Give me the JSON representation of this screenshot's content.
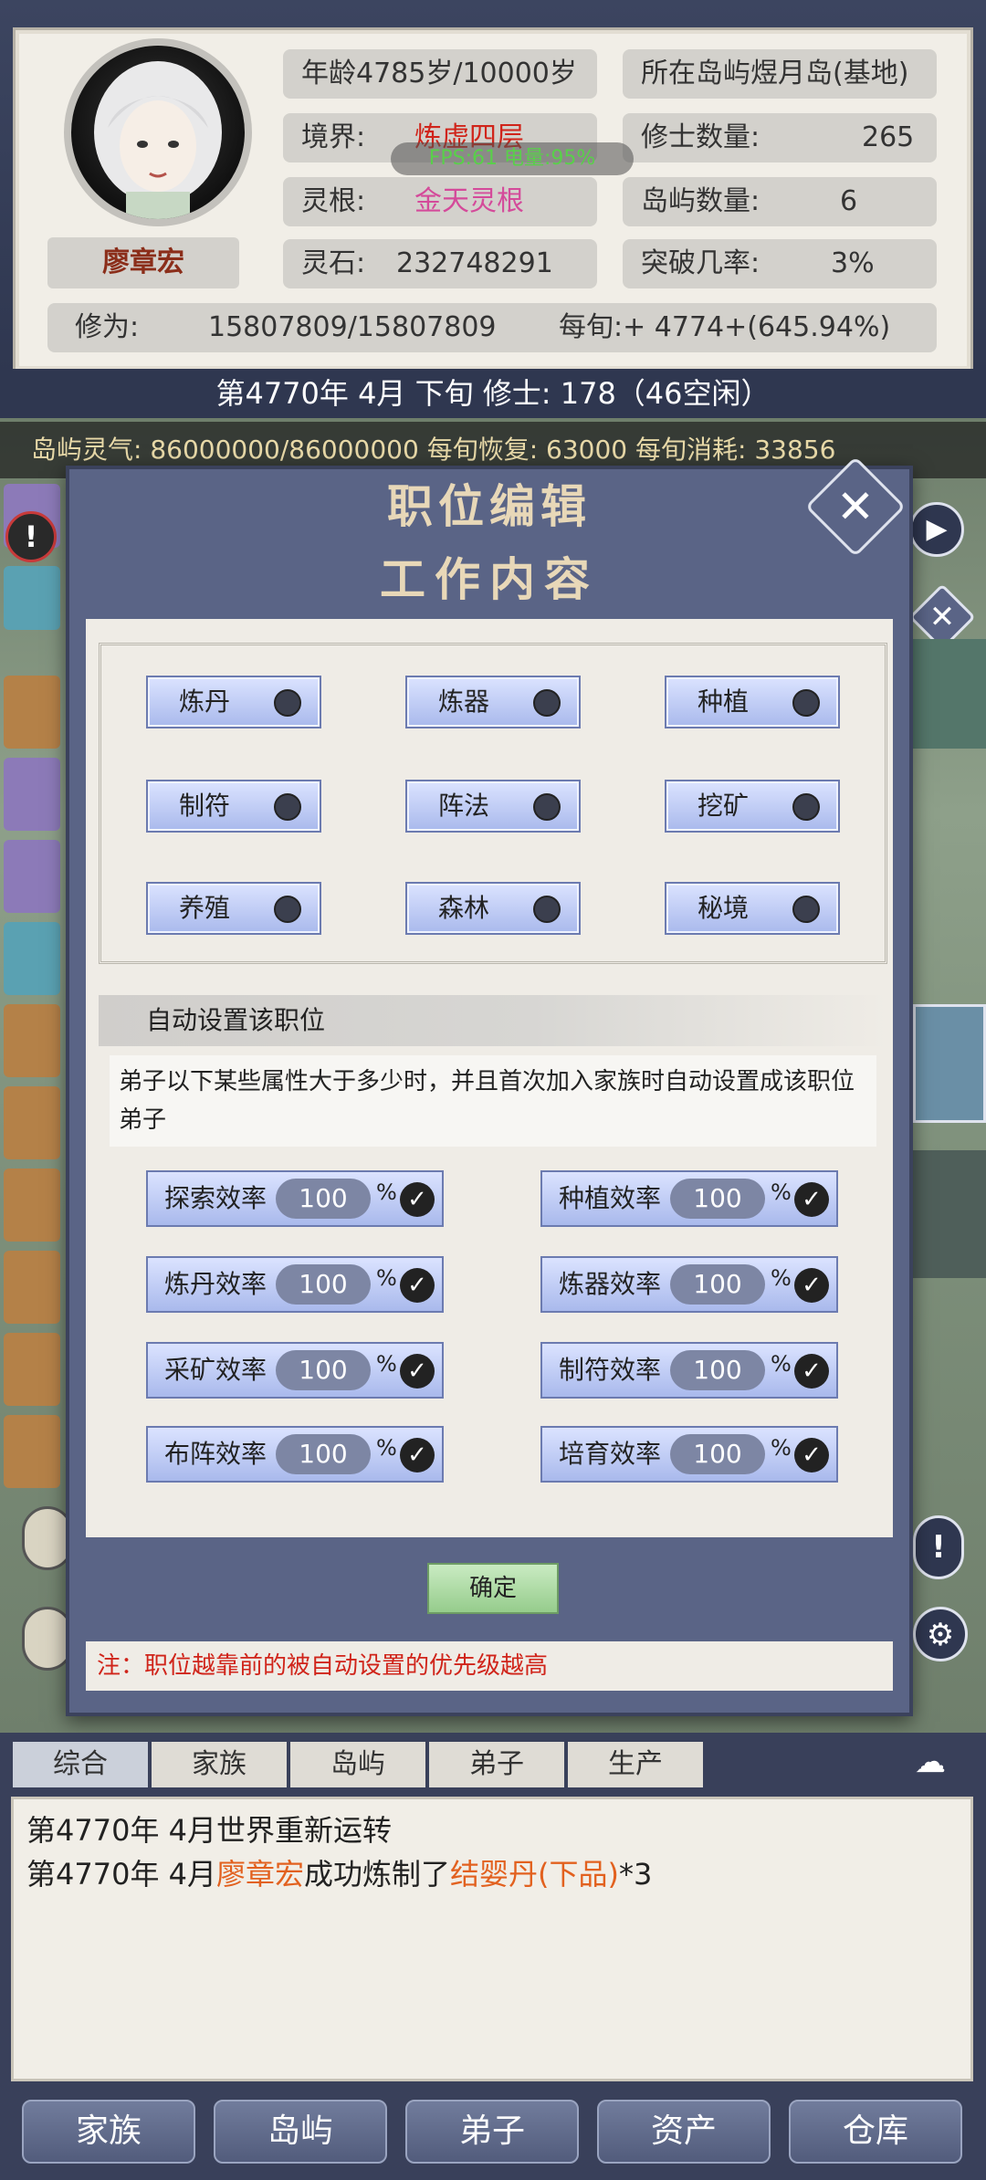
{
  "header": {
    "name": "廖章宏",
    "age": "年龄4785岁/10000岁",
    "island": "所在岛屿煜月岛(基地)",
    "realm_label": "境界:",
    "realm_value": "炼虚四层",
    "cultivators_label": "修士数量:",
    "cultivators_value": "265",
    "root_label": "灵根:",
    "root_value": "金天灵根",
    "islands_label": "岛屿数量:",
    "islands_value": "6",
    "stone_label": "灵石:",
    "stone_value": "232748291",
    "breakthrough_label": "突破几率:",
    "breakthrough_value": "3%",
    "xiuwei_label": "修为:",
    "xiuwei_value": "15807809/15807809",
    "per_xun": "每旬:+ 4774+(645.94%)",
    "fps_text": "FPS:61  电量:95%"
  },
  "date_bar": {
    "text": "第4770年 4月 下旬    修士: 178（46空闲）"
  },
  "qi_bar": {
    "text": "岛屿灵气: 86000000/86000000    每旬恢复: 63000  每旬消耗: 33856"
  },
  "modal": {
    "title": "职位编辑",
    "subtitle": "工作内容",
    "jobs": [
      "炼丹",
      "炼器",
      "种植",
      "制符",
      "阵法",
      "挖矿",
      "养殖",
      "森林",
      "秘境"
    ],
    "auto_heading": "自动设置该职位",
    "auto_desc": "弟子以下某些属性大于多少时，并且首次加入家族时自动设置成该职位弟子",
    "efficiencies": [
      {
        "label": "探索效率",
        "value": "100"
      },
      {
        "label": "种植效率",
        "value": "100"
      },
      {
        "label": "炼丹效率",
        "value": "100"
      },
      {
        "label": "炼器效率",
        "value": "100"
      },
      {
        "label": "采矿效率",
        "value": "100"
      },
      {
        "label": "制符效率",
        "value": "100"
      },
      {
        "label": "布阵效率",
        "value": "100"
      },
      {
        "label": "培育效率",
        "value": "100"
      }
    ],
    "percent_sign": "%",
    "confirm_label": "确定",
    "note": "注：职位越靠前的被自动设置的优先级越高"
  },
  "log": {
    "tabs": [
      "综合",
      "家族",
      "岛屿",
      "弟子",
      "生产"
    ],
    "line1": "第4770年 4月世界重新运转",
    "line2_prefix": "第4770年 4月",
    "line2_name": "廖章宏",
    "line2_mid": "成功炼制了",
    "line2_item": "结婴丹(下品)",
    "line2_suffix": "*3"
  },
  "nav": [
    "家族",
    "岛屿",
    "弟子",
    "资产",
    "仓库"
  ],
  "colors": {
    "realm": "#d0241a",
    "root": "#d44a9a",
    "highlight": "#e2611f"
  }
}
